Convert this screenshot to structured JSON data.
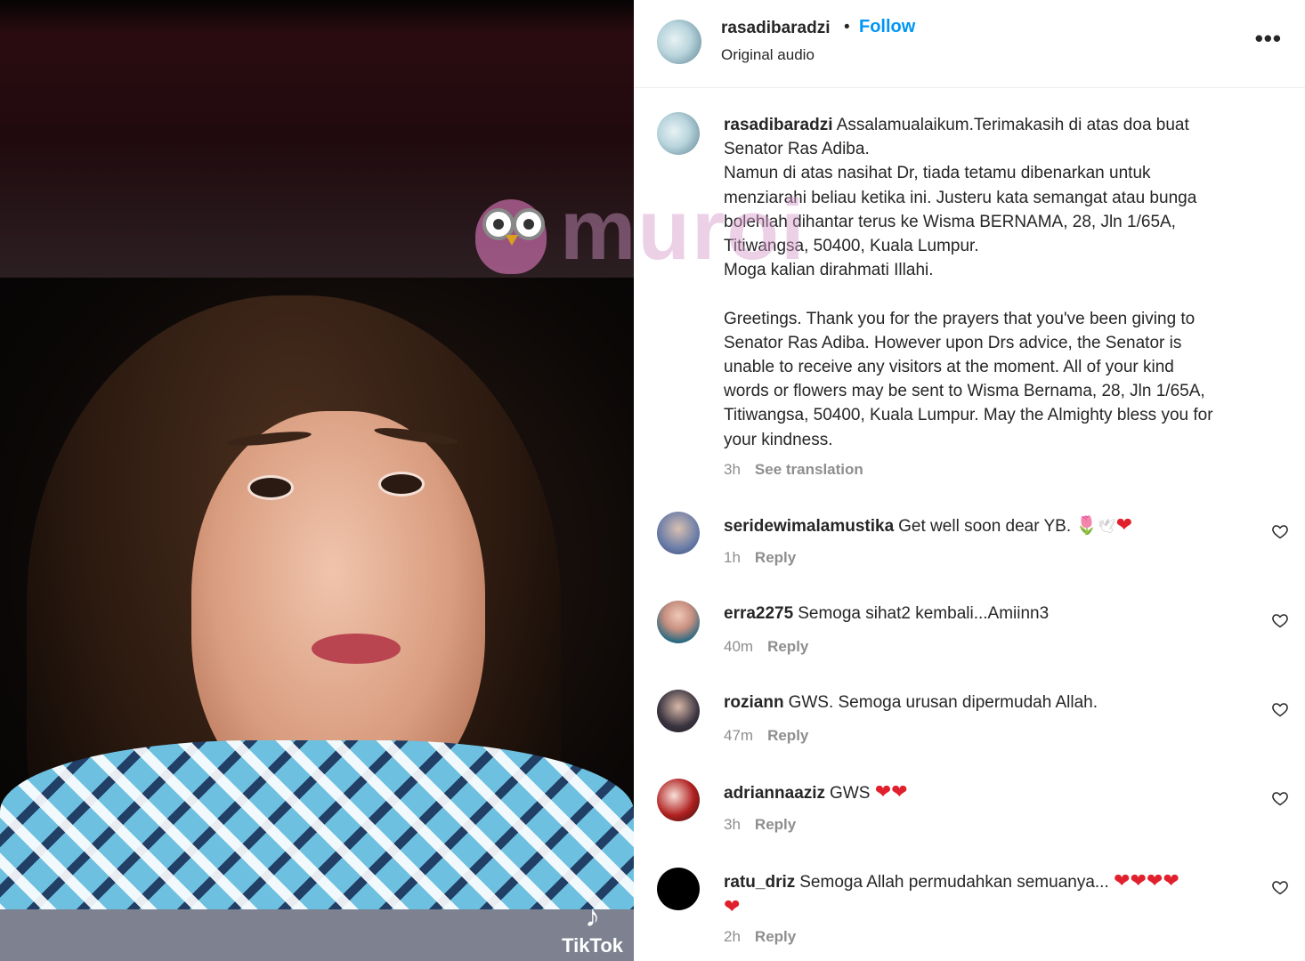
{
  "video": {
    "watermark_text": "muroi",
    "tiktok_label": "TikTok",
    "tiktok_icon": "tiktok-note-icon"
  },
  "header": {
    "username": "rasadibaradzi",
    "separator": "•",
    "follow_label": "Follow",
    "audio": "Original audio",
    "more_icon": "more-horizontal-icon",
    "more_label": "•••"
  },
  "caption": {
    "username": "rasadibaradzi",
    "text": "Assalamualaikum.Terimakasih di atas doa buat\nSenator Ras Adiba.\nNamun di atas nasihat Dr, tiada tetamu dibenarkan untuk\nmenziarahi beliau ketika ini. Justeru kata semangat atau bunga\nbolehlah dihantar terus ke Wisma BERNAMA, 28, Jln 1/65A,\nTitiwangsa, 50400, Kuala Lumpur.\nMoga kalian dirahmati Illahi.\n\nGreetings. Thank you for the prayers that you've been giving to\nSenator Ras Adiba. However upon Drs advice, the Senator is\nunable to receive any visitors at the moment. All of your kind\nwords or flowers may be sent to Wisma Bernama, 28, Jln 1/65A,\nTitiwangsa, 50400, Kuala Lumpur. May the Almighty bless you for\nyour kindness.",
    "time": "3h",
    "see_translation": "See translation"
  },
  "comments": [
    {
      "username": "seridewimalamustika",
      "text": "Get well soon dear YB.",
      "emojis": [
        "🌷",
        "🕊",
        "❤"
      ],
      "time": "1h",
      "reply": "Reply"
    },
    {
      "username": "erra2275",
      "text": "Semoga sihat2 kembali...Amiinn3",
      "emojis": [],
      "time": "40m",
      "reply": "Reply"
    },
    {
      "username": "roziann",
      "text": "GWS. Semoga urusan dipermudah Allah.",
      "emojis": [],
      "time": "47m",
      "reply": "Reply"
    },
    {
      "username": "adriannaaziz",
      "text": "GWS",
      "emojis": [
        "❤",
        "❤"
      ],
      "time": "3h",
      "reply": "Reply"
    },
    {
      "username": "ratu_driz",
      "text": "Semoga Allah permudahkan semuanya...",
      "emojis": [
        "❤",
        "❤",
        "❤",
        "❤",
        "❤"
      ],
      "time": "2h",
      "reply": "Reply"
    }
  ],
  "colors": {
    "accent": "#0095f6",
    "text": "#262626",
    "secondary": "#8e8e8e",
    "heart_emoji": "#e0212d"
  }
}
